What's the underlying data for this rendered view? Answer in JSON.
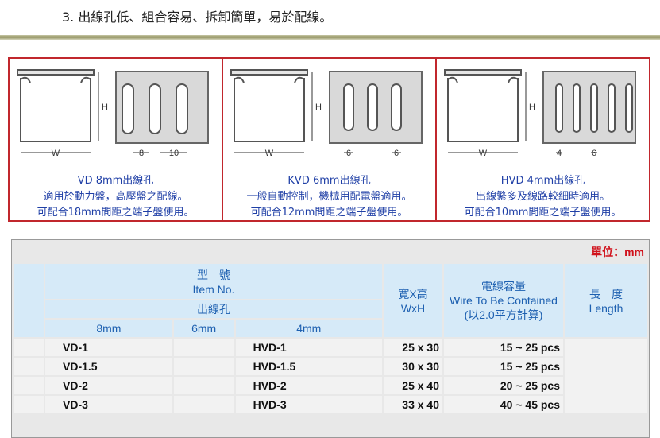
{
  "heading": "3. 出線孔低、組合容易、拆卸簡單，易於配線。",
  "panels": [
    {
      "title": "VD 8mm出線孔",
      "line1": "適用於動力盤，高壓盤之配線。",
      "line2": "可配合18mm間距之端子盤使用。",
      "dim_w": "W",
      "dim_h": "H",
      "dim_a": "8",
      "dim_b": "10"
    },
    {
      "title": "KVD 6mm出線孔",
      "line1": "一般自動控制，機械用配電盤適用。",
      "line2": "可配合12mm間距之端子盤使用。",
      "dim_w": "W",
      "dim_h": "H",
      "dim_a": "6",
      "dim_b": "6"
    },
    {
      "title": "HVD 4mm出線孔",
      "line1": "出線繁多及線路較細時適用。",
      "line2": "可配合10mm間距之端子盤使用。",
      "dim_w": "W",
      "dim_h": "H",
      "dim_a": "4",
      "dim_b": "6"
    }
  ],
  "table": {
    "unit": "單位：mm",
    "item_zh": "型　號",
    "item_en": "Item No.",
    "hole_label": "出線孔",
    "col_8": "8mm",
    "col_6": "6mm",
    "col_4": "4mm",
    "wh_zh": "寬X高",
    "wh_en": "WxH",
    "wire_zh": "電線容量",
    "wire_en": "Wire To Be Contained",
    "wire_note": "(以2.0平方計算)",
    "len_zh": "長　度",
    "len_en": "Length",
    "rows": [
      {
        "vd": "VD-1",
        "kvd": "",
        "hvd": "HVD-1",
        "wh": "25 x 30",
        "cap": "15 ~ 25 pcs"
      },
      {
        "vd": "VD-1.5",
        "kvd": "",
        "hvd": "HVD-1.5",
        "wh": "30 x 30",
        "cap": "15 ~ 25 pcs"
      },
      {
        "vd": "VD-2",
        "kvd": "",
        "hvd": "HVD-2",
        "wh": "25 x 40",
        "cap": "20 ~ 25 pcs"
      },
      {
        "vd": "VD-3",
        "kvd": "",
        "hvd": "HVD-3",
        "wh": "33 x 40",
        "cap": "40 ~ 45 pcs"
      }
    ]
  }
}
